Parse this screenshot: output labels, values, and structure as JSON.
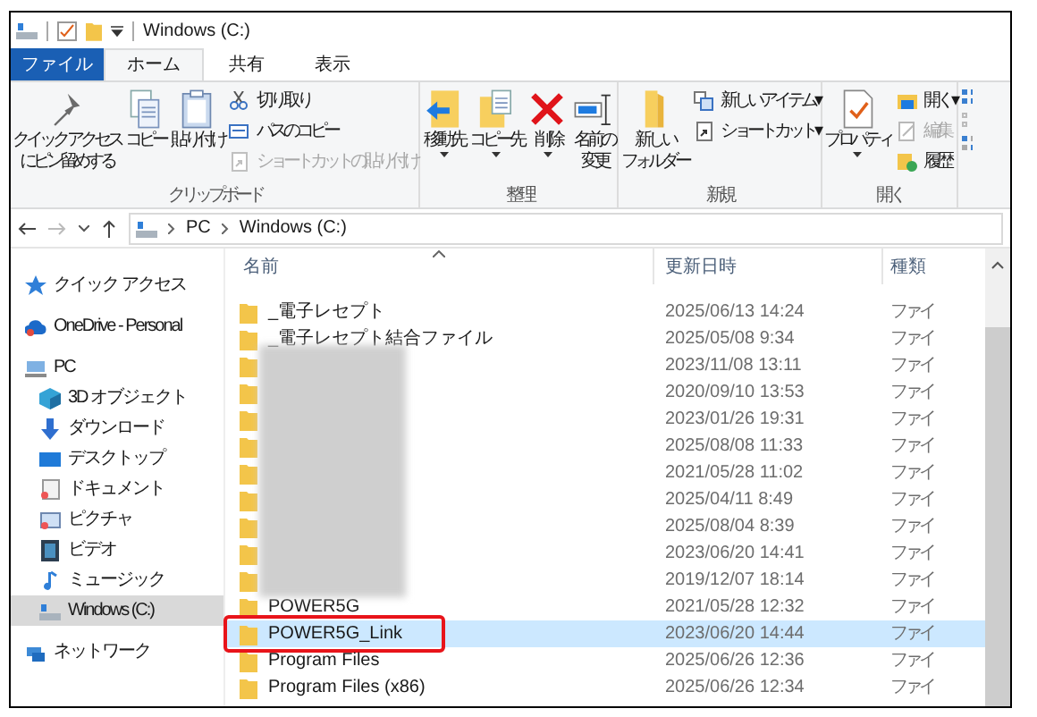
{
  "window": {
    "title": "Windows (C:)"
  },
  "tabs": [
    {
      "label": "ファイル",
      "kind": "file",
      "selected": false
    },
    {
      "label": "ホーム",
      "kind": "tab",
      "selected": true
    },
    {
      "label": "共有",
      "kind": "tab",
      "selected": false
    },
    {
      "label": "表示",
      "kind": "tab",
      "selected": false
    }
  ],
  "ribbon": {
    "groups": [
      {
        "label": "クリップボード",
        "large": [
          {
            "lines": [
              "クイック アクセス",
              "にピン留めする"
            ],
            "dropdown": false
          },
          {
            "lines": [
              "コピー"
            ],
            "dropdown": false
          },
          {
            "lines": [
              "貼り付け"
            ],
            "dropdown": false
          }
        ],
        "small": [
          {
            "label": "切り取り",
            "disabled": false
          },
          {
            "label": "パスのコピー",
            "disabled": false
          },
          {
            "label": "ショートカットの貼り付け",
            "disabled": true
          }
        ]
      },
      {
        "label": "整理",
        "large": [
          {
            "lines": [
              "移動先"
            ],
            "dropdown": true
          },
          {
            "lines": [
              "コピー先"
            ],
            "dropdown": true
          },
          {
            "lines": [
              "削除"
            ],
            "dropdown": true
          },
          {
            "lines": [
              "名前の",
              "変更"
            ],
            "dropdown": false
          }
        ]
      },
      {
        "label": "新規",
        "large": [
          {
            "lines": [
              "新しい",
              "フォルダー"
            ],
            "dropdown": false
          }
        ],
        "small": [
          {
            "label": "新しいアイテム ▾",
            "disabled": false
          },
          {
            "label": "ショートカット ▾",
            "disabled": false
          }
        ]
      },
      {
        "label": "開く",
        "large": [
          {
            "lines": [
              "プロパティ"
            ],
            "dropdown": true
          }
        ],
        "small": [
          {
            "label": "開く ▾",
            "disabled": false
          },
          {
            "label": "編集",
            "disabled": true
          },
          {
            "label": "履歴",
            "disabled": false
          }
        ]
      }
    ]
  },
  "address": {
    "path": [
      "PC",
      "Windows (C:)"
    ]
  },
  "sidebar": {
    "items": [
      {
        "label": "クイック アクセス",
        "selected": false
      },
      {
        "label": "OneDrive - Personal",
        "selected": false
      },
      {
        "label": "PC",
        "selected": false,
        "children": [
          {
            "label": "3D オブジェクト",
            "selected": false
          },
          {
            "label": "ダウンロード",
            "selected": false
          },
          {
            "label": "デスクトップ",
            "selected": false
          },
          {
            "label": "ドキュメント",
            "selected": false
          },
          {
            "label": "ピクチャ",
            "selected": false
          },
          {
            "label": "ビデオ",
            "selected": false
          },
          {
            "label": "ミュージック",
            "selected": false
          },
          {
            "label": "Windows (C:)",
            "selected": true
          }
        ]
      },
      {
        "label": "ネットワーク",
        "selected": false
      }
    ]
  },
  "table": {
    "columns": [
      "名前",
      "更新日時",
      "種類"
    ],
    "rows": [
      {
        "kind": "file",
        "name": "_電子レセプト",
        "date": "2025/06/13 14:24",
        "type": "ファイ",
        "selected": false
      },
      {
        "kind": "file",
        "name": "_電子レセプト結合ファイル",
        "date": "2025/05/08 9:34",
        "type": "ファイ",
        "selected": false
      },
      {
        "kind": "redacted",
        "date": "2023/11/08 13:11",
        "type": "ファイ",
        "selected": false
      },
      {
        "kind": "redacted",
        "date": "2020/09/10 13:53",
        "type": "ファイ",
        "selected": false
      },
      {
        "kind": "redacted",
        "date": "2023/01/26 19:31",
        "type": "ファイ",
        "selected": false
      },
      {
        "kind": "redacted",
        "date": "2025/08/08 11:33",
        "type": "ファイ",
        "selected": false
      },
      {
        "kind": "redacted",
        "date": "2021/05/28 11:02",
        "type": "ファイ",
        "selected": false
      },
      {
        "kind": "redacted",
        "date": "2025/04/11 8:49",
        "type": "ファイ",
        "selected": false
      },
      {
        "kind": "redacted",
        "date": "2025/08/04 8:39",
        "type": "ファイ",
        "selected": false
      },
      {
        "kind": "redacted",
        "date": "2023/06/20 14:41",
        "type": "ファイ",
        "selected": false
      },
      {
        "kind": "redacted",
        "date": "2019/12/07 18:14",
        "type": "ファイ",
        "selected": false
      },
      {
        "kind": "file",
        "name": "POWER5G",
        "date": "2021/05/28 12:32",
        "type": "ファイ",
        "selected": false
      },
      {
        "kind": "file",
        "name": "POWER5G_Link",
        "date": "2023/06/20 14:44",
        "type": "ファイ",
        "selected": true,
        "circled": true
      },
      {
        "kind": "file",
        "name": "Program Files",
        "date": "2025/06/26 12:36",
        "type": "ファイ",
        "selected": false
      },
      {
        "kind": "file",
        "name": "Program Files (x86)",
        "date": "2025/06/26 12:34",
        "type": "ファイ",
        "selected": false
      }
    ]
  }
}
